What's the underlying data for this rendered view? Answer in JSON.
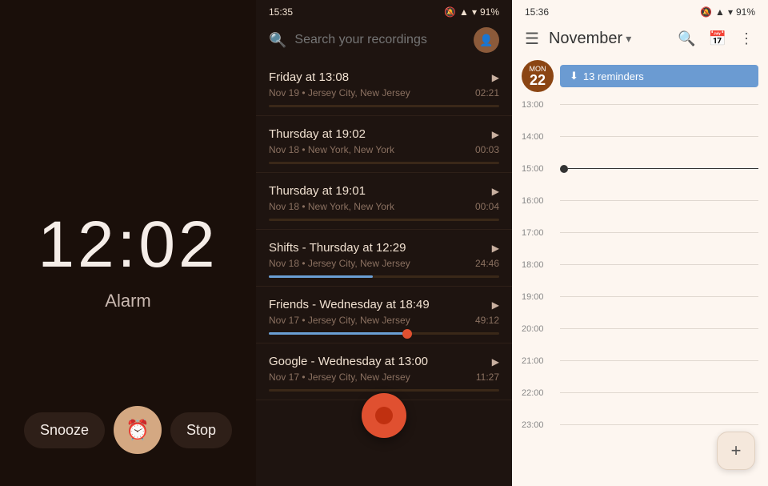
{
  "alarm": {
    "time": "12:02",
    "label": "Alarm",
    "snooze": "Snooze",
    "stop": "Stop",
    "icon": "⏰"
  },
  "recordings": {
    "status_time": "15:35",
    "battery": "91%",
    "search_placeholder": "Search your recordings",
    "items": [
      {
        "title": "Friday at 13:08",
        "date": "Nov 19",
        "location": "Jersey City, New Jersey",
        "duration": "02:21",
        "progress": 0,
        "has_thumb": false
      },
      {
        "title": "Thursday at 19:02",
        "date": "Nov 18",
        "location": "New York, New York",
        "duration": "00:03",
        "progress": 0,
        "has_thumb": false
      },
      {
        "title": "Thursday at 19:01",
        "date": "Nov 18",
        "location": "New York, New York",
        "duration": "00:04",
        "progress": 0,
        "has_thumb": false
      },
      {
        "title": "Shifts - Thursday at 12:29",
        "date": "Nov 18",
        "location": "Jersey City, New Jersey",
        "duration": "24:46",
        "progress": 45,
        "has_thumb": false
      },
      {
        "title": "Friends - Wednesday at 18:49",
        "date": "Nov 17",
        "location": "Jersey City, New Jersey",
        "duration": "49:12",
        "progress": 60,
        "has_thumb": true
      },
      {
        "title": "Google - Wednesday at 13:00",
        "date": "Nov 17",
        "location": "Jersey City, New Jersey",
        "duration": "11:27",
        "progress": 0,
        "has_thumb": false
      }
    ]
  },
  "calendar": {
    "status_time": "15:36",
    "battery": "91%",
    "month": "November",
    "date_day": "Mon",
    "date_num": "22",
    "reminder_count": "13 reminders",
    "time_slots": [
      "13:00",
      "14:00",
      "15:00",
      "16:00",
      "17:00",
      "18:00",
      "19:00",
      "20:00",
      "21:00",
      "22:00",
      "23:00"
    ],
    "current_time_index": 2,
    "fab_icon": "+",
    "menu_icon": "☰",
    "search_icon": "🔍",
    "calendar_icon": "📅",
    "more_icon": "⋮"
  }
}
